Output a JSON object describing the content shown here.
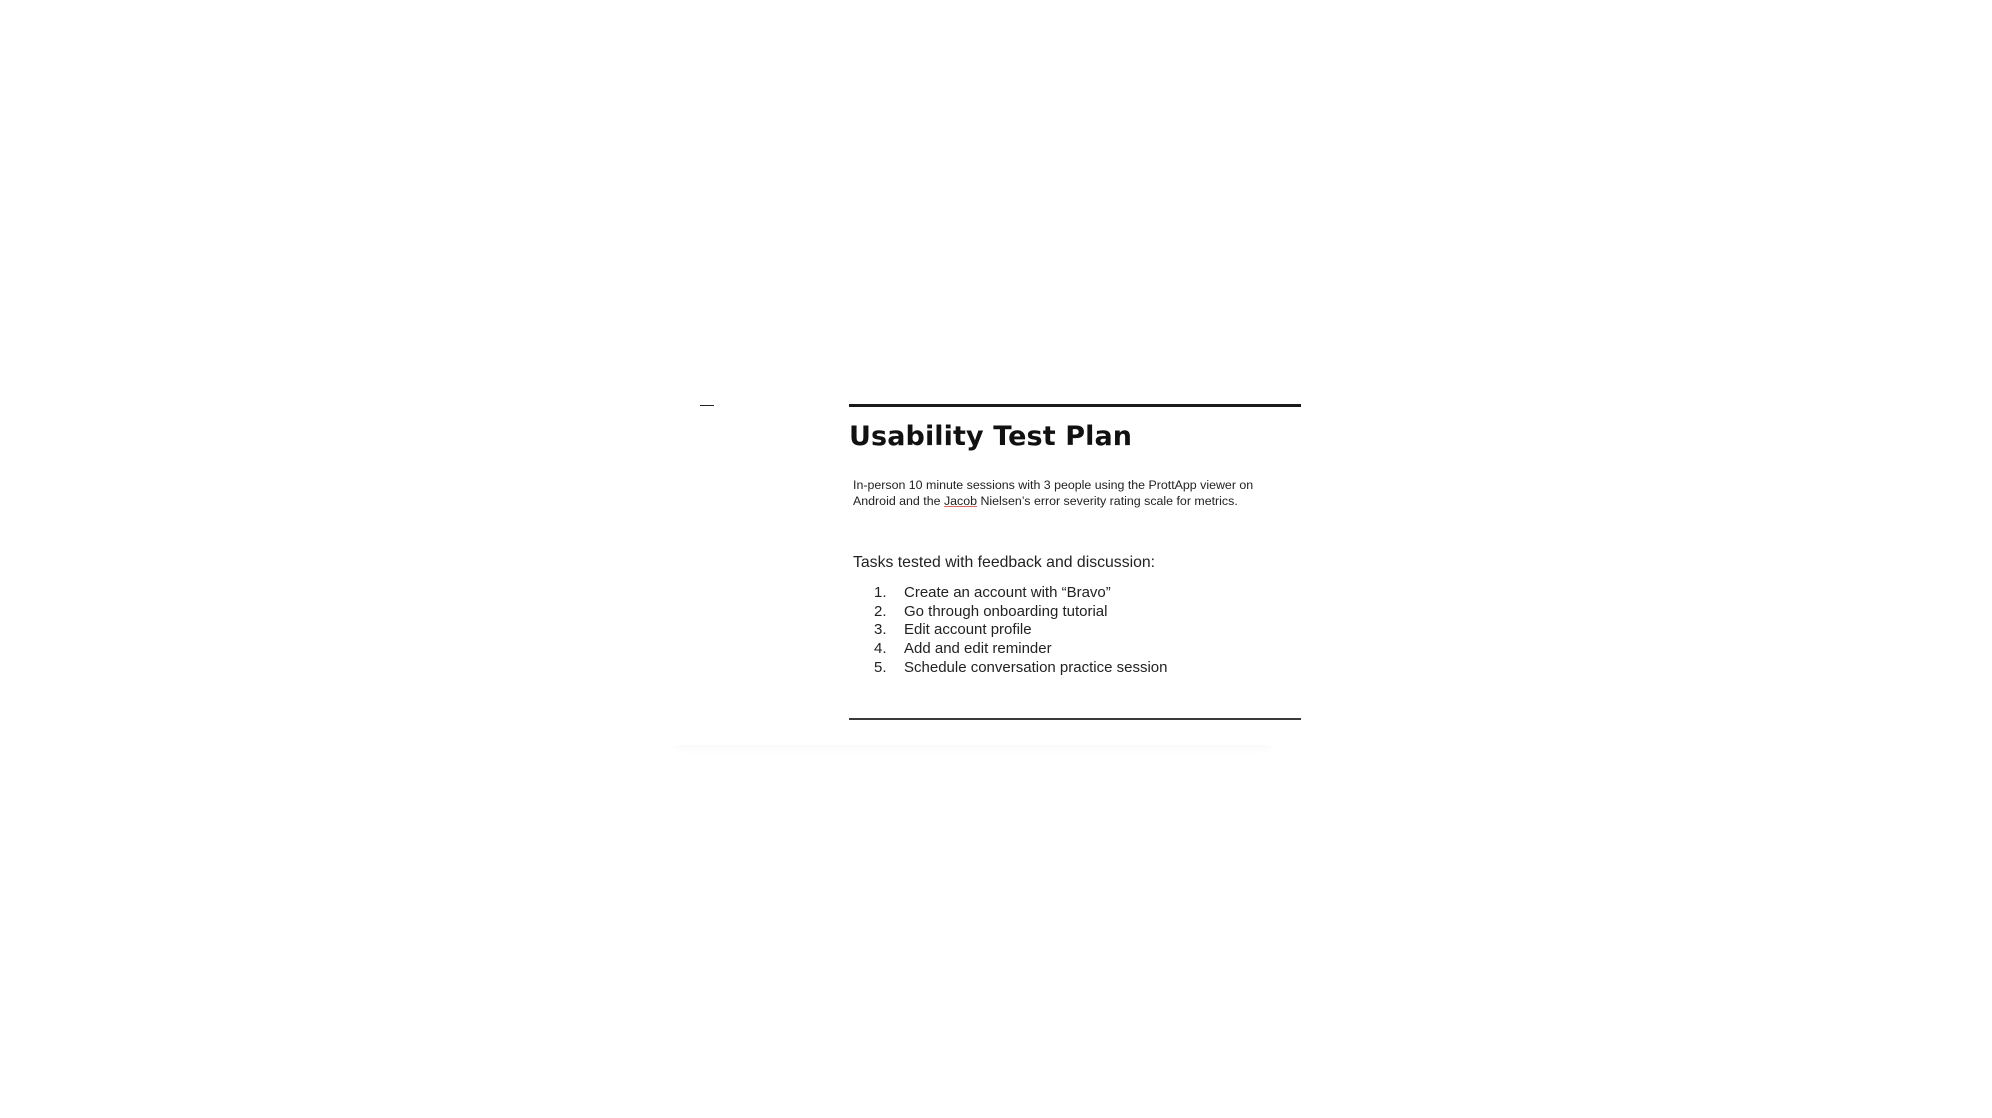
{
  "document": {
    "title": "Usability Test Plan",
    "intro": {
      "before": "In-person 10 minute sessions with 3 people using the ProttApp viewer on Android and the ",
      "underlined": "Jacob",
      "after": " Nielsen’s error severity rating scale for metrics."
    },
    "tasks_heading": "Tasks tested with feedback and discussion:",
    "tasks": [
      {
        "number": "1.",
        "text": "Create an account with “Bravo”"
      },
      {
        "number": "2.",
        "text": "Go through onboarding tutorial"
      },
      {
        "number": "3.",
        "text": "Edit account profile"
      },
      {
        "number": "4.",
        "text": "Add and edit reminder"
      },
      {
        "number": "5.",
        "text": "Schedule conversation practice session"
      }
    ]
  }
}
